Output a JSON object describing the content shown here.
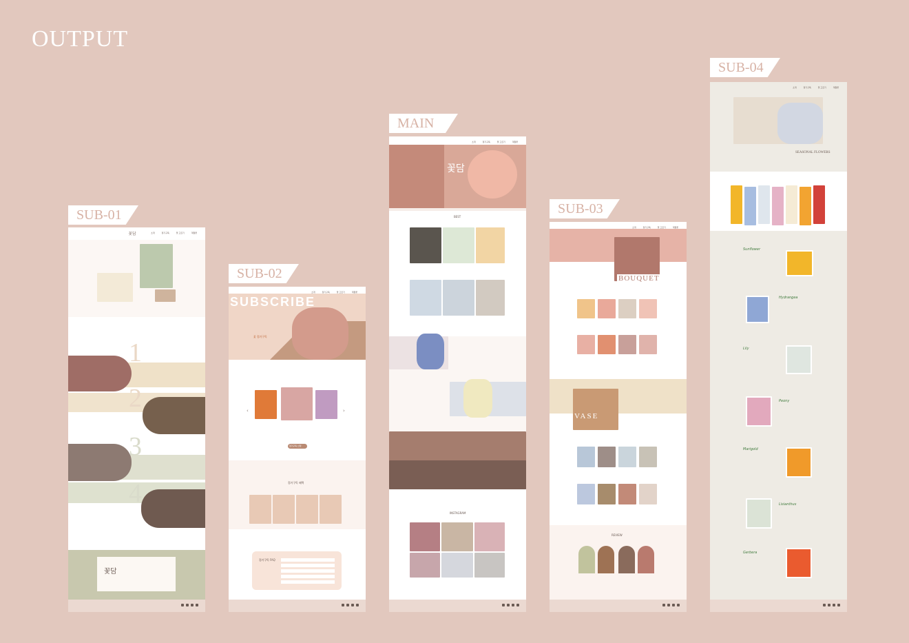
{
  "heading": "OUTPUT",
  "labels": {
    "sub01": "SUB-01",
    "sub02": "SUB-02",
    "main": "MAIN",
    "sub03": "SUB-03",
    "sub04": "SUB-04"
  },
  "sub01": {
    "steps": [
      "1",
      "2",
      "3",
      "4"
    ]
  },
  "sub02": {
    "hero": "SUBSCRIBE",
    "benefits_title": "정기구독 혜택",
    "faq_title": "정기구독 FAQ",
    "button": "정기구독 신청"
  },
  "main": {
    "logo": "꽃담",
    "best": "BEST",
    "instagram": "INSTAGRAM"
  },
  "sub03": {
    "bouquet": "BOUQUET",
    "vase": "VASE",
    "review": "REVIEW"
  },
  "sub04": {
    "hero_caption": "SEASONAL FLOWERS",
    "flowers": [
      "Sunflower",
      "Hydrangea",
      "Lily",
      "Peony",
      "Marigold",
      "Lisianthus",
      "Gerbera"
    ]
  },
  "colors": {
    "background": "#e2c8be",
    "accent": "#d9a898"
  }
}
